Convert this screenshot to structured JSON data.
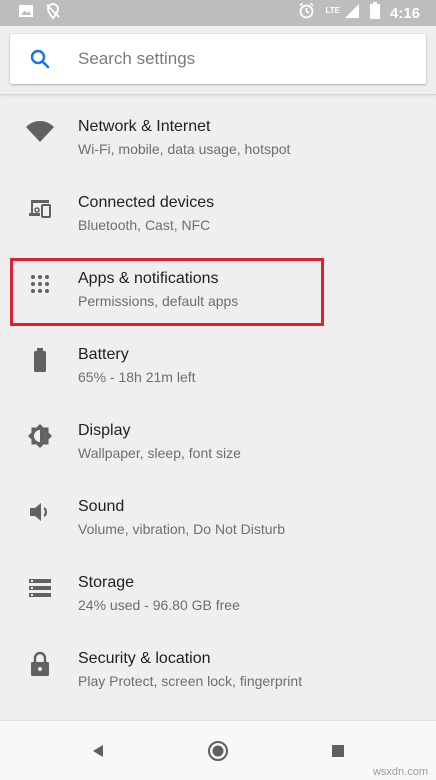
{
  "status_bar": {
    "time": "4:16",
    "network_label": "LTE",
    "icons": [
      "image-icon",
      "no-location-icon",
      "alarm-icon",
      "signal-icon",
      "battery-icon"
    ]
  },
  "search": {
    "placeholder": "Search settings",
    "icon": "search-icon"
  },
  "settings": [
    {
      "id": "network",
      "title": "Network & Internet",
      "subtitle": "Wi-Fi, mobile, data usage, hotspot",
      "icon": "wifi-icon"
    },
    {
      "id": "devices",
      "title": "Connected devices",
      "subtitle": "Bluetooth, Cast, NFC",
      "icon": "devices-icon"
    },
    {
      "id": "apps",
      "title": "Apps & notifications",
      "subtitle": "Permissions, default apps",
      "icon": "apps-grid-icon",
      "highlighted": true
    },
    {
      "id": "battery",
      "title": "Battery",
      "subtitle": "65% - 18h 21m left",
      "icon": "battery-icon"
    },
    {
      "id": "display",
      "title": "Display",
      "subtitle": "Wallpaper, sleep, font size",
      "icon": "brightness-icon"
    },
    {
      "id": "sound",
      "title": "Sound",
      "subtitle": "Volume, vibration, Do Not Disturb",
      "icon": "volume-icon"
    },
    {
      "id": "storage",
      "title": "Storage",
      "subtitle": "24% used - 96.80 GB free",
      "icon": "storage-icon"
    },
    {
      "id": "security",
      "title": "Security & location",
      "subtitle": "Play Protect, screen lock, fingerprint",
      "icon": "lock-icon"
    }
  ],
  "nav_bar": {
    "buttons": [
      "back-icon",
      "home-icon",
      "recents-icon"
    ]
  },
  "colors": {
    "accent": "#1a73e8",
    "icon_gray": "#616161",
    "highlight_border": "#e0202e",
    "status_bar": "#bdbdbd",
    "background": "#efefef"
  },
  "watermark": "wsxdn.com"
}
